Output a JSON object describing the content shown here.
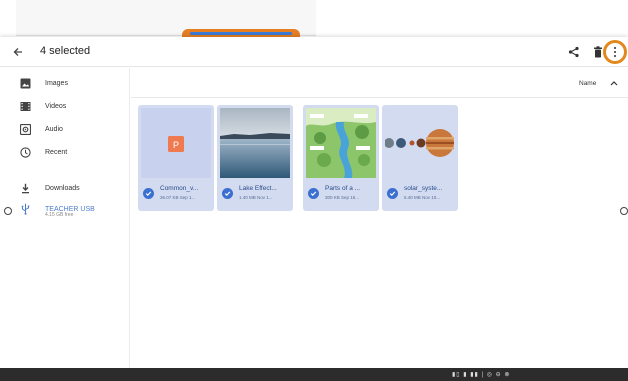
{
  "toolbar": {
    "selection_title": "4 selected",
    "icons": [
      "back-arrow-icon",
      "share-icon",
      "trash-icon",
      "more-vert-icon"
    ]
  },
  "sidebar": {
    "items": [
      {
        "label": "Images",
        "icon": "image-icon"
      },
      {
        "label": "Videos",
        "icon": "video-icon"
      },
      {
        "label": "Audio",
        "icon": "audio-icon"
      },
      {
        "label": "Recent",
        "icon": "clock-icon"
      },
      {
        "label": "Downloads",
        "icon": "download-icon"
      },
      {
        "label": "TEACHER USB",
        "sublabel": "4.15 GB free",
        "icon": "usb-icon",
        "active": true
      }
    ]
  },
  "sort": {
    "label": "Name",
    "direction_icon": "chevron-up-icon"
  },
  "files": [
    {
      "name": "Common_v...",
      "meta": "36.07 KB Sep 1...",
      "thumb_type": "document",
      "selected": true
    },
    {
      "name": "Lake Effect...",
      "meta": "1.40 MB Nov 1...",
      "thumb_type": "lake-photo",
      "selected": true
    },
    {
      "name": "Parts of a ...",
      "meta": "300 KB Sep 15...",
      "thumb_type": "diagram",
      "selected": true
    },
    {
      "name": "solar_syste...",
      "meta": "6.40 MB Nov 10...",
      "thumb_type": "planets",
      "selected": true
    }
  ],
  "taskbar": {
    "tray_text": "▮▯ ▮ ▮▮ | ◎ ⊖ ⊗"
  },
  "colors": {
    "accent": "#3b6fd0",
    "tile_selected": "#d3dbf1",
    "highlight_ring": "#e08a1e"
  }
}
